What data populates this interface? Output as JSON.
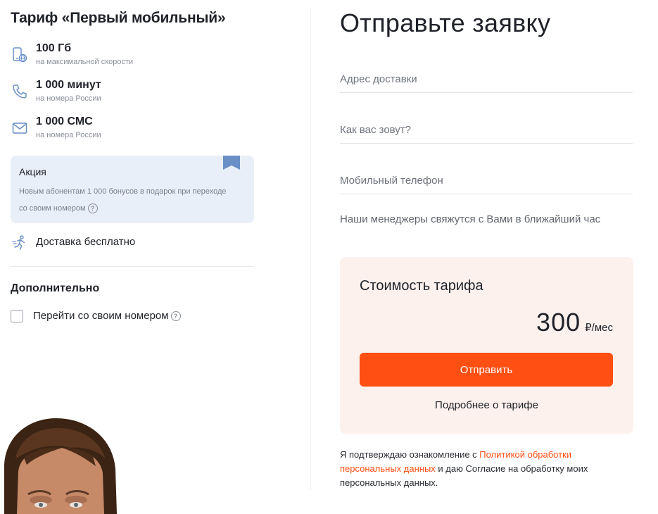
{
  "plan": {
    "title": "Тариф «Первый мобильный»",
    "features": [
      {
        "icon": "mobile-internet-icon",
        "main": "100 Гб",
        "sub": "на максимальной скорости"
      },
      {
        "icon": "phone-icon",
        "main": "1 000 минут",
        "sub": "на номера России"
      },
      {
        "icon": "envelope-icon",
        "main": "1 000 СМС",
        "sub": "на номера России"
      }
    ],
    "promo": {
      "title": "Акция",
      "text": "Новым абонентам 1 000 бонусов в подарок при переходе со своим номером",
      "help_glyph": "?"
    },
    "delivery": {
      "icon": "running-courier-icon",
      "text": "Доставка бесплатно"
    },
    "extra": {
      "title": "Дополнительно",
      "checkbox_label": "Перейти со своим номером",
      "checked": false,
      "help_glyph": "?"
    }
  },
  "form": {
    "title": "Отправьте заявку",
    "fields": [
      {
        "placeholder": "Адрес доставки",
        "value": ""
      },
      {
        "placeholder": "Как вас зовут?",
        "value": ""
      },
      {
        "placeholder": "Мобильный телефон",
        "value": ""
      }
    ],
    "manager_note": "Наши менеджеры свяжутся с Вами в ближайший час",
    "price_card": {
      "title": "Стоимость тарифа",
      "amount": "300",
      "unit": "₽/мес",
      "submit_label": "Отправить",
      "more_label": "Подробнее о тарифе"
    },
    "consent": {
      "before": "Я подтверждаю ознакомление с ",
      "link": "Политикой обработки персональных данных",
      "after": " и даю Согласие на обработку моих персональных данных."
    }
  },
  "colors": {
    "accent": "#ff4f12",
    "promo_bg": "#e9eff8",
    "price_card_bg": "#fdf1ee",
    "icon_blue": "#6a8fc7",
    "text_main": "#1f2229"
  }
}
